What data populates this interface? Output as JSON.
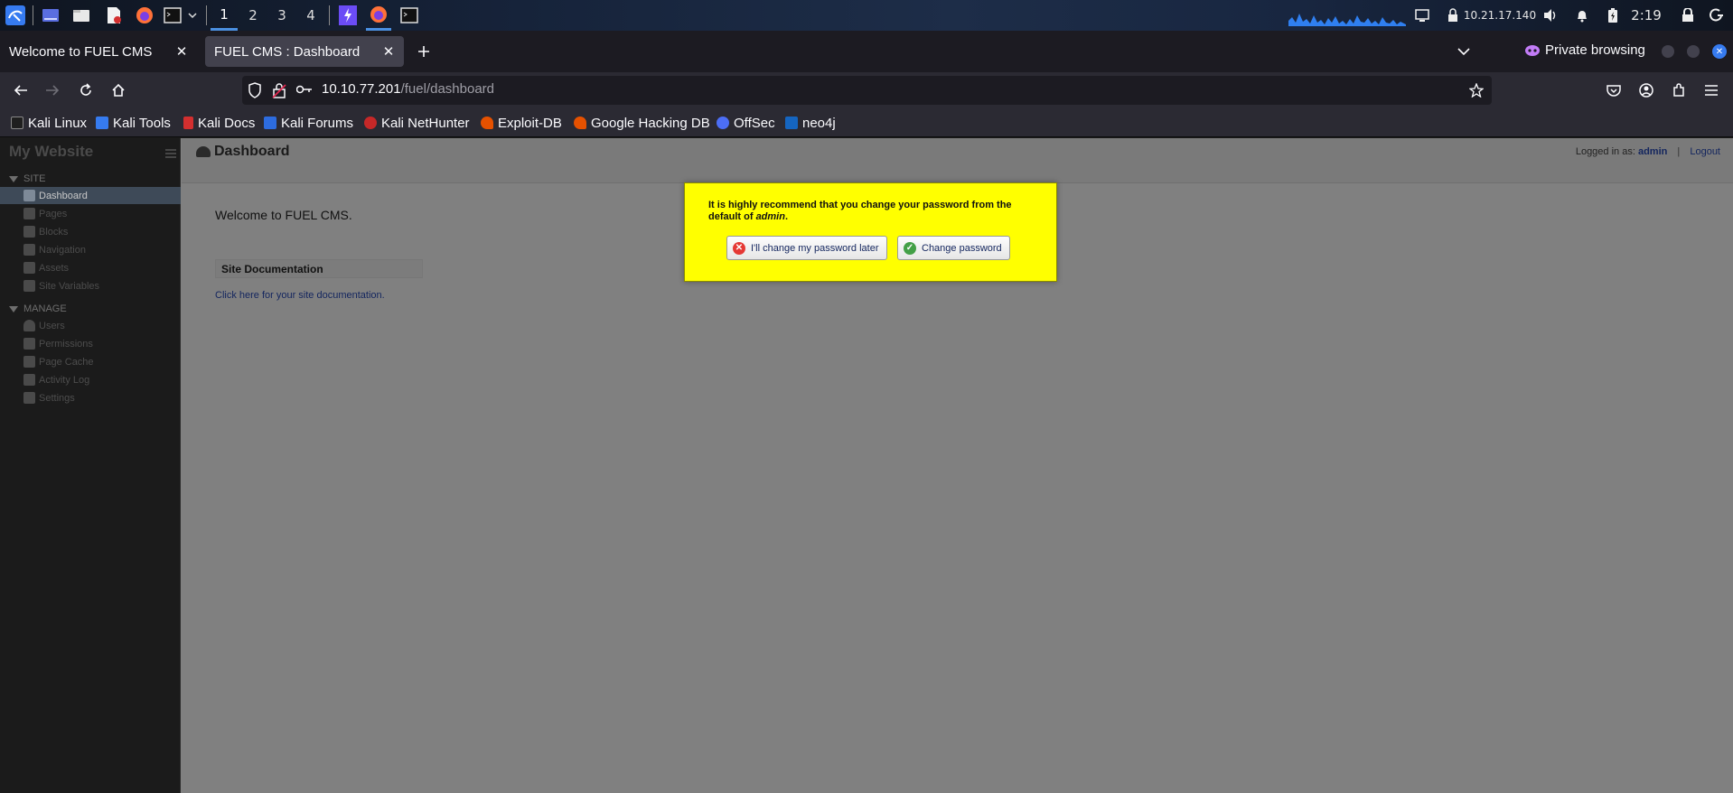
{
  "taskbar": {
    "workspaces": [
      "1",
      "2",
      "3",
      "4"
    ],
    "active_workspace": "1",
    "ip": "10.21.17.140",
    "clock": "2:19"
  },
  "browser": {
    "tabs": [
      {
        "title": "Welcome to FUEL CMS",
        "active": false
      },
      {
        "title": "FUEL CMS : Dashboard",
        "active": true
      }
    ],
    "private_label": "Private browsing",
    "url_host": "10.10.77.201",
    "url_path": "/fuel/dashboard",
    "bookmarks": [
      {
        "label": "Kali Linux",
        "color": "#1f1f1f"
      },
      {
        "label": "Kali Tools",
        "color": "#367bf0"
      },
      {
        "label": "Kali Docs",
        "color": "#d32f2f"
      },
      {
        "label": "Kali Forums",
        "color": "#2d6cdf"
      },
      {
        "label": "Kali NetHunter",
        "color": "#c62828"
      },
      {
        "label": "Exploit-DB",
        "color": "#e65100"
      },
      {
        "label": "Google Hacking DB",
        "color": "#e65100"
      },
      {
        "label": "OffSec",
        "color": "#4c6ef5"
      },
      {
        "label": "neo4j",
        "color": "#1565c0"
      }
    ]
  },
  "fuel": {
    "site_name": "My Website",
    "sections": [
      {
        "title": "SITE",
        "items": [
          "Dashboard",
          "Pages",
          "Blocks",
          "Navigation",
          "Assets",
          "Site Variables"
        ]
      },
      {
        "title": "MANAGE",
        "items": [
          "Users",
          "Permissions",
          "Page Cache",
          "Activity Log",
          "Settings"
        ]
      }
    ],
    "active_item": "Dashboard",
    "page_title": "Dashboard",
    "logged_in_label": "Logged in as:",
    "logged_in_user": "admin",
    "logout_label": "Logout",
    "welcome": "Welcome to FUEL CMS.",
    "doc_title": "Site Documentation",
    "doc_link": "Click here for your site documentation.",
    "modal": {
      "message_pre": "It is highly recommend that you change your password from the default of ",
      "message_user": "admin",
      "message_post": ".",
      "later_button": "I'll change my password later",
      "change_button": "Change password",
      "bg_color": "#ffff00"
    }
  }
}
